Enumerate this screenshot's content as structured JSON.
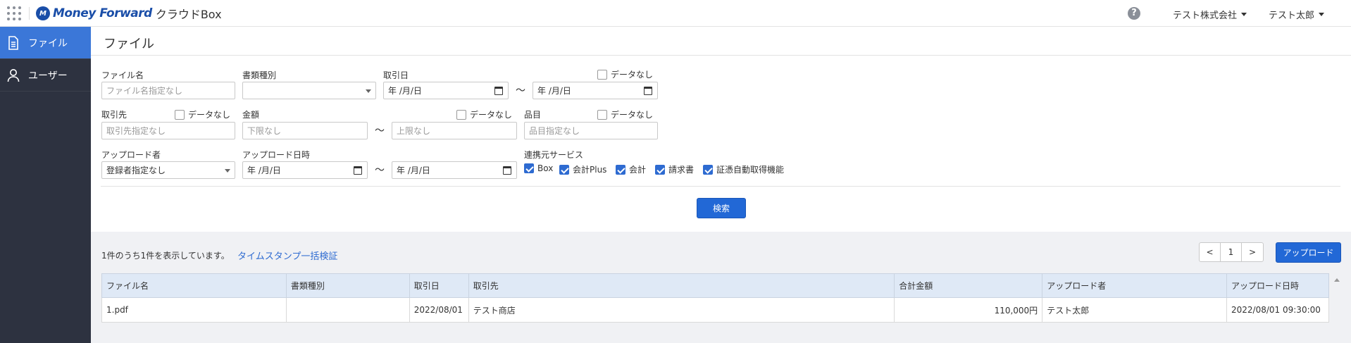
{
  "header": {
    "brand": "Money Forward",
    "product": "クラウドBox",
    "company": "テスト株式会社",
    "user": "テスト太郎"
  },
  "sidebar": {
    "items": [
      {
        "label": "ファイル",
        "icon": "document-icon",
        "active": true
      },
      {
        "label": "ユーザー",
        "icon": "user-icon",
        "active": false
      }
    ]
  },
  "page": {
    "title": "ファイル"
  },
  "form": {
    "file_name": {
      "label": "ファイル名",
      "placeholder": "ファイル名指定なし"
    },
    "doc_type": {
      "label": "書類種別",
      "value": ""
    },
    "tx_date": {
      "label": "取引日",
      "from": "年 /月/日",
      "to": "年 /月/日",
      "no_data": "データなし"
    },
    "partner": {
      "label": "取引先",
      "placeholder": "取引先指定なし",
      "no_data": "データなし"
    },
    "amount": {
      "label": "金額",
      "min_placeholder": "下限なし",
      "max_placeholder": "上限なし",
      "no_data": "データなし"
    },
    "item": {
      "label": "品目",
      "placeholder": "品目指定なし",
      "no_data": "データなし"
    },
    "uploader": {
      "label": "アップロード者",
      "value": "登録者指定なし"
    },
    "upload_dt": {
      "label": "アップロード日時",
      "from": "年 /月/日",
      "to": "年 /月/日"
    },
    "services": {
      "label": "連携元サービス",
      "options": [
        {
          "label": "Box",
          "checked": true
        },
        {
          "label": "会計Plus",
          "checked": true
        },
        {
          "label": "会計",
          "checked": true
        },
        {
          "label": "請求書",
          "checked": true
        },
        {
          "label": "証憑自動取得機能",
          "checked": true
        }
      ]
    },
    "tilde": "〜",
    "search_button": "検索"
  },
  "results": {
    "count_text": "1件のうち1件を表示しています。",
    "verify_link": "タイムスタンプ一括検証",
    "pager": {
      "prev": "<",
      "page": "1",
      "next": ">"
    },
    "upload_button": "アップロード",
    "columns": [
      "ファイル名",
      "書類種別",
      "取引日",
      "取引先",
      "合計金額",
      "アップロード者",
      "アップロード日時"
    ],
    "rows": [
      [
        "1.pdf",
        "",
        "2022/08/01",
        "テスト商店",
        "110,000円",
        "テスト太郎",
        "2022/08/01 09:30:00"
      ]
    ]
  },
  "colors": {
    "sidebar_bg": "#2d3240",
    "sidebar_active": "#3b77d8",
    "primary": "#2268d6",
    "table_header": "#dfe9f6"
  }
}
